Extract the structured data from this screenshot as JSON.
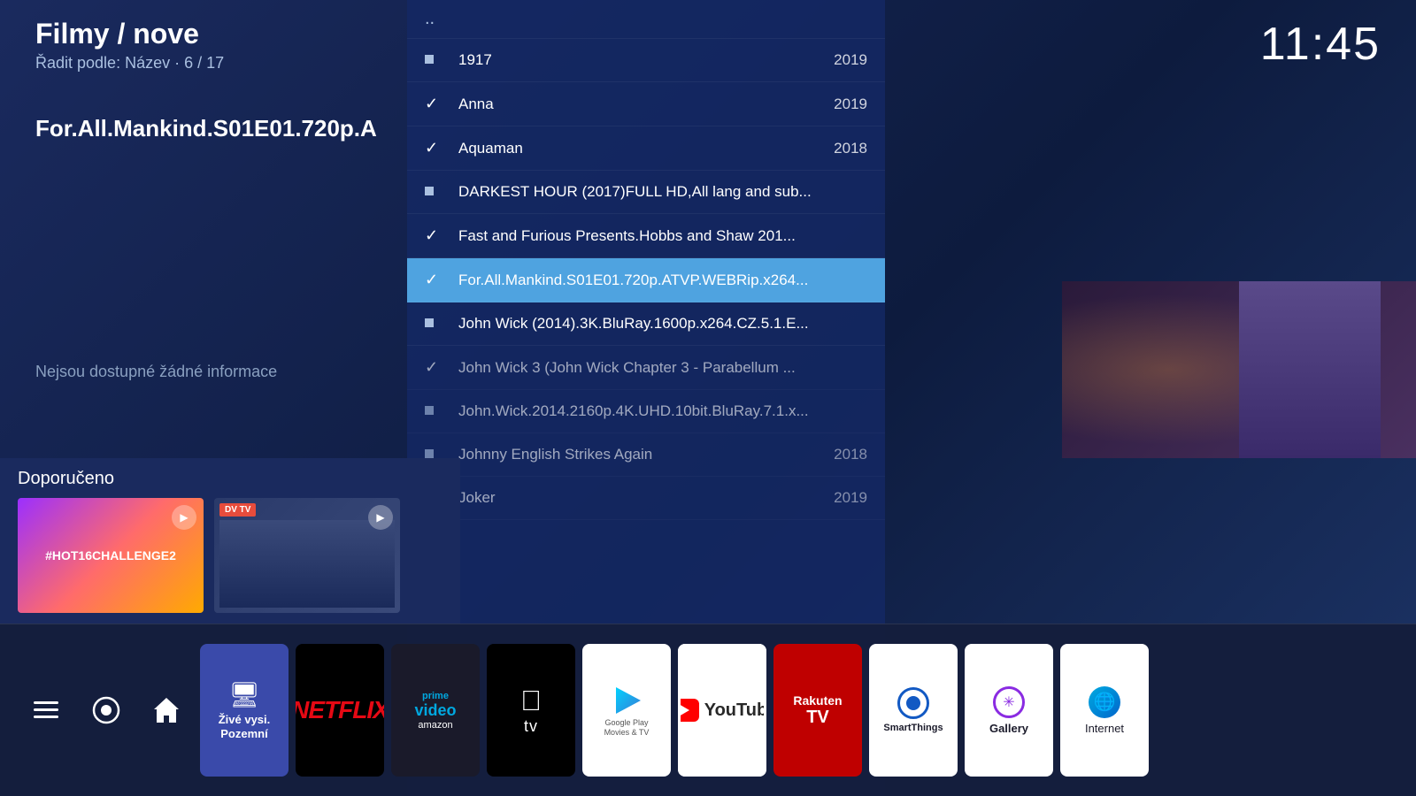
{
  "header": {
    "title": "Filmy / nove",
    "subtitle": "Řadit podle: Název  ·  6 / 17"
  },
  "clock": "11:45",
  "movie_title": "For.All.Mankind.S01E01.720p.A",
  "no_info": "Nejsou dostupné žádné informace",
  "list": {
    "dotdot": "..",
    "items": [
      {
        "id": "1917",
        "icon": "square",
        "title": "1917",
        "year": "2019",
        "selected": false,
        "checked": false
      },
      {
        "id": "anna",
        "icon": "check",
        "title": "Anna",
        "year": "2019",
        "selected": false,
        "checked": true
      },
      {
        "id": "aquaman",
        "icon": "check",
        "title": "Aquaman",
        "year": "2018",
        "selected": false,
        "checked": true
      },
      {
        "id": "darkest",
        "icon": "square",
        "title": "DARKEST HOUR (2017)FULL HD,All lang and sub...",
        "year": "",
        "selected": false,
        "checked": false
      },
      {
        "id": "fast",
        "icon": "check",
        "title": "Fast and Furious Presents.Hobbs and Shaw 201...",
        "year": "",
        "selected": false,
        "checked": true
      },
      {
        "id": "formankind",
        "icon": "check",
        "title": "For.All.Mankind.S01E01.720p.ATVP.WEBRip.x264...",
        "year": "",
        "selected": true,
        "checked": true
      },
      {
        "id": "johnwick2014",
        "icon": "square",
        "title": "John Wick (2014).3K.BluRay.1600p.x264.CZ.5.1.E...",
        "year": "",
        "selected": false,
        "checked": false
      },
      {
        "id": "johnwick3",
        "icon": "check",
        "title": "John Wick 3 (John Wick Chapter 3 - Parabellum ...",
        "year": "",
        "selected": false,
        "checked": true,
        "dimmed": true
      },
      {
        "id": "johnwick4k",
        "icon": "square",
        "title": "John.Wick.2014.2160p.4K.UHD.10bit.BluRay.7.1.x...",
        "year": "",
        "selected": false,
        "checked": false,
        "dimmed": true
      },
      {
        "id": "johnnyenglish",
        "icon": "square",
        "title": "Johnny English Strikes Again",
        "year": "2018",
        "selected": false,
        "checked": false,
        "dimmed": true
      },
      {
        "id": "joker",
        "icon": "square",
        "title": "Joker",
        "year": "2019",
        "selected": false,
        "checked": false,
        "dimmed": true
      }
    ]
  },
  "recommended": {
    "label": "Doporučeno",
    "items": [
      {
        "id": "hot16",
        "label": "#HOT16CHALLENGE2"
      },
      {
        "id": "dv",
        "label": "DVTV"
      }
    ]
  },
  "taskbar": {
    "icons": [
      {
        "id": "menu",
        "label": ""
      },
      {
        "id": "pinterest",
        "label": ""
      },
      {
        "id": "home",
        "label": ""
      }
    ],
    "apps": [
      {
        "id": "live",
        "label": "Živé vysi.",
        "sublabel": "Pozemní"
      },
      {
        "id": "netflix",
        "label": "NETFLIX"
      },
      {
        "id": "prime",
        "label": "prime video"
      },
      {
        "id": "appletv",
        "label": "tv"
      },
      {
        "id": "googlemovies",
        "label": "Google Play Movies & TV"
      },
      {
        "id": "youtube",
        "label": "YouTube",
        "selected": true
      },
      {
        "id": "rakuten",
        "label": "Rakuten TV"
      },
      {
        "id": "smartthings",
        "label": "SmartThings"
      },
      {
        "id": "gallery",
        "label": "Gallery"
      },
      {
        "id": "internet",
        "label": "Internet"
      }
    ]
  }
}
